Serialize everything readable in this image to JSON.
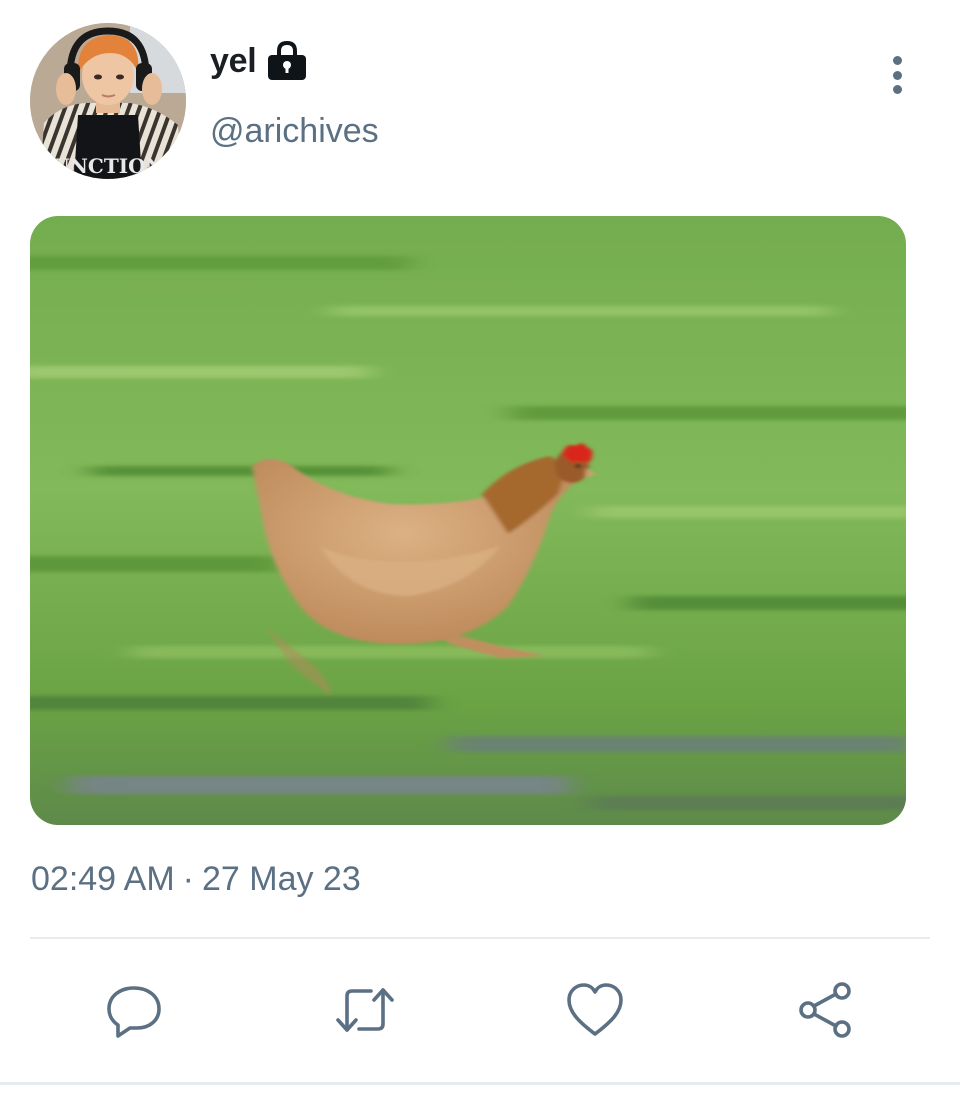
{
  "user": {
    "display_name": "yel",
    "handle": "@arichives",
    "protected_icon": "lock-icon",
    "avatar_shirt_text": "UNCTION"
  },
  "menu": {
    "icon": "more-vertical-icon"
  },
  "media": {
    "subject": "chicken running across grass",
    "colors": {
      "grass": "#6fae4a",
      "chicken": "#c9955f",
      "comb": "#d9271c"
    }
  },
  "timestamp": {
    "time": "02:49 AM",
    "separator": "·",
    "date": "27 May 23"
  },
  "actions": {
    "reply_icon": "reply-icon",
    "retweet_icon": "retweet-icon",
    "like_icon": "heart-icon",
    "share_icon": "share-icon"
  },
  "colors": {
    "secondary_text": "#5b7083",
    "divider": "#e6ecf0"
  }
}
